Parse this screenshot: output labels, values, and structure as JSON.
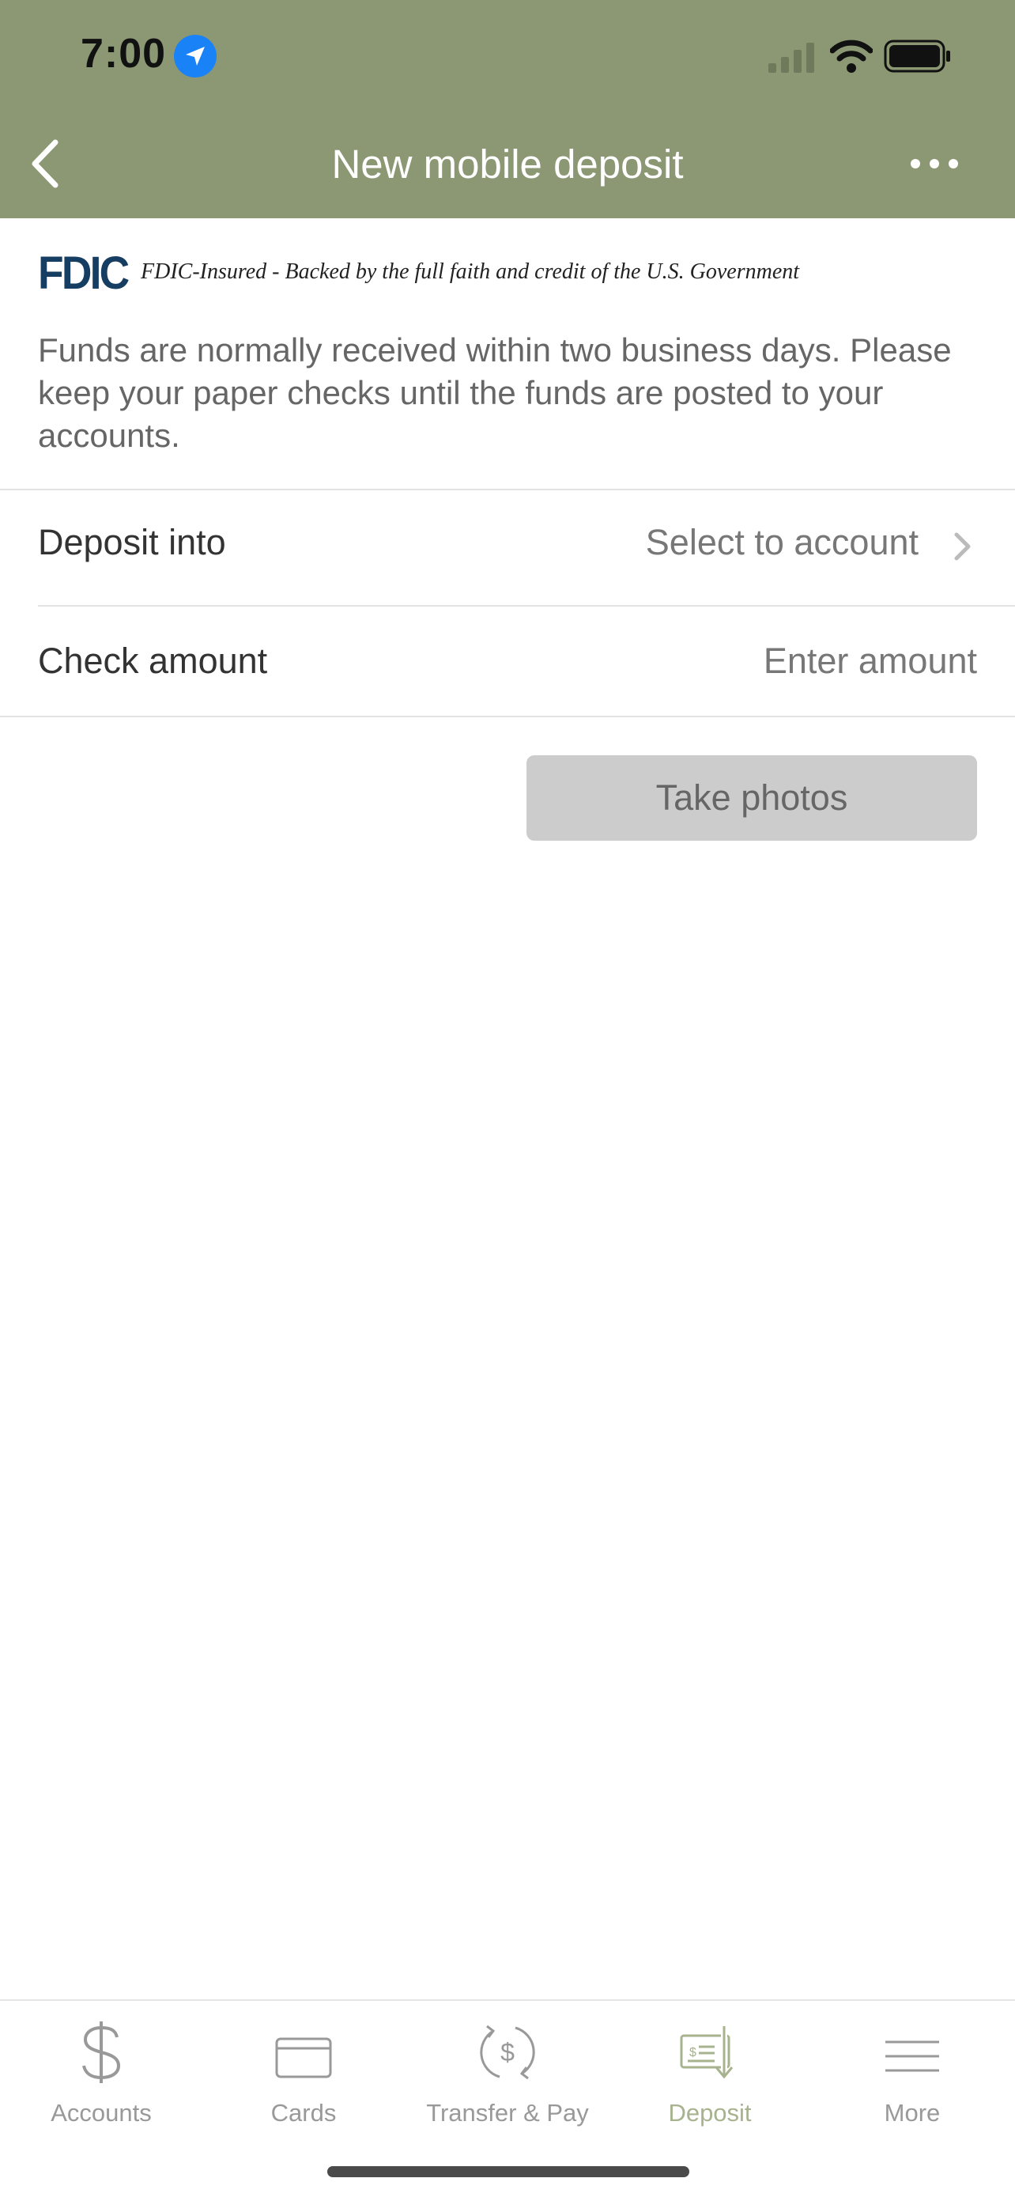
{
  "status_bar": {
    "time": "7:00"
  },
  "nav": {
    "title": "New mobile deposit"
  },
  "fdic": {
    "logo": "FDIC",
    "text": "FDIC-Insured - Backed by the full faith and credit of the U.S. Government"
  },
  "notice": "Funds are normally received within two business days. Please keep your paper checks until the funds are posted to your accounts.",
  "form": {
    "deposit_into": {
      "label": "Deposit into",
      "value": "Select to account"
    },
    "check_amount": {
      "label": "Check amount",
      "placeholder": "Enter amount"
    }
  },
  "take_photos": {
    "label": "Take photos"
  },
  "tabs": [
    {
      "label": "Accounts",
      "icon": "dollar-icon"
    },
    {
      "label": "Cards",
      "icon": "card-icon"
    },
    {
      "label": "Transfer & Pay",
      "icon": "transfer-icon"
    },
    {
      "label": "Deposit",
      "icon": "deposit-check-icon",
      "active": true
    },
    {
      "label": "More",
      "icon": "menu-icon"
    }
  ],
  "colors": {
    "header": "#8b9873",
    "active_tab": "#a7b28f",
    "fdic_blue": "#163e62"
  }
}
